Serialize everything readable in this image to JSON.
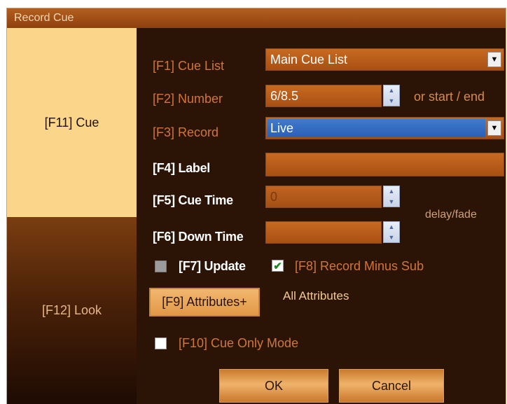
{
  "window": {
    "title": "Record Cue"
  },
  "tabs": {
    "cue": "[F11] Cue",
    "look": "[F12] Look"
  },
  "form": {
    "cue_list_label": "[F1] Cue List",
    "cue_list_value": "Main Cue List",
    "number_label": "[F2] Number",
    "number_value": "6/8.5",
    "number_hint": "or start / end",
    "record_label": "[F3] Record",
    "record_value": "Live",
    "label_label": "[F4] Label",
    "label_value": "",
    "cue_time_label": "[F5] Cue Time",
    "cue_time_value": "0",
    "delay_fade_label": "delay/fade",
    "down_time_label": "[F6] Down Time",
    "down_time_value": "",
    "update_label": "[F7] Update",
    "update_checked": false,
    "record_minus_sub_label": "[F8] Record Minus Sub",
    "record_minus_sub_checked": true,
    "attributes_button": "[F9] Attributes+",
    "attributes_value": "All Attributes",
    "cue_only_label": "[F10] Cue Only Mode",
    "cue_only_checked": false
  },
  "buttons": {
    "ok": "OK",
    "cancel": "Cancel"
  },
  "icons": {
    "dropdown": "chevron-down-icon",
    "spinner": "spinner-arrows-icon",
    "check": "check-icon"
  },
  "colors": {
    "background": "#2b1305",
    "title_bar": "#a04e14",
    "selected_tab": "#fbd58a",
    "field": "#b85c18",
    "highlight": "#3a74cc"
  }
}
